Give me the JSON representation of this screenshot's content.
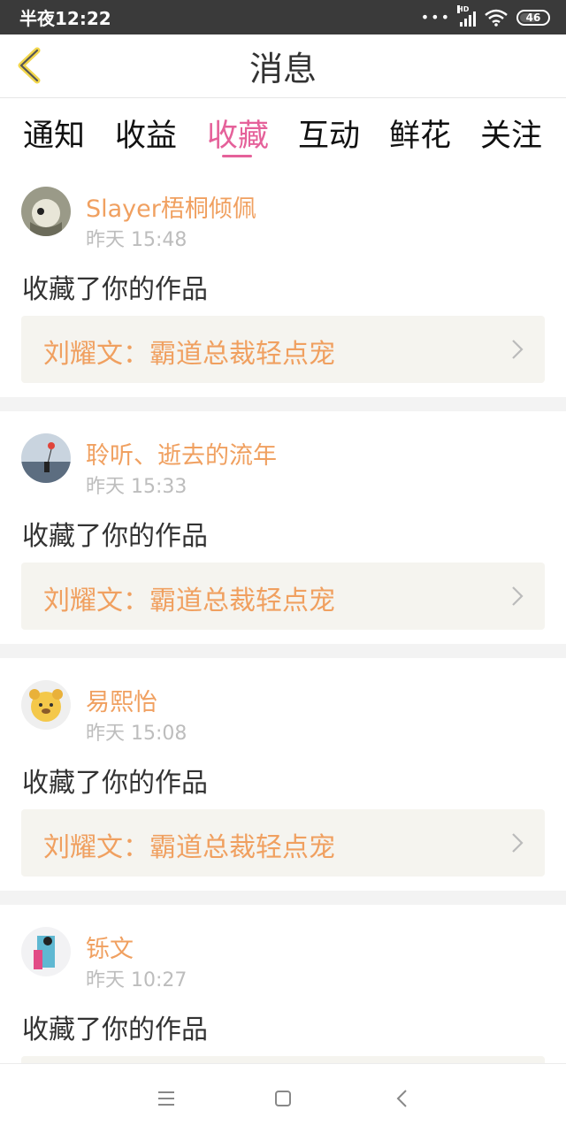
{
  "status": {
    "time": "半夜12:22",
    "signal_label": "HD",
    "battery": "46"
  },
  "header": {
    "title": "消息"
  },
  "tabs": [
    {
      "label": "通知"
    },
    {
      "label": "收益"
    },
    {
      "label": "收藏",
      "active": true
    },
    {
      "label": "互动"
    },
    {
      "label": "鲜花"
    },
    {
      "label": "关注"
    }
  ],
  "messages": [
    {
      "user": "Slayer梧桐倾佩",
      "time": "昨天 15:48",
      "action": "收藏了你的作品",
      "work": "刘耀文：霸道总裁轻点宠"
    },
    {
      "user": "聆听、逝去的流年",
      "time": "昨天 15:33",
      "action": "收藏了你的作品",
      "work": "刘耀文：霸道总裁轻点宠"
    },
    {
      "user": "易熙怡",
      "time": "昨天 15:08",
      "action": "收藏了你的作品",
      "work": "刘耀文：霸道总裁轻点宠"
    },
    {
      "user": "铄文",
      "time": "昨天 10:27",
      "action": "收藏了你的作品",
      "work": ""
    }
  ],
  "colors": {
    "accent": "#e5619a",
    "username": "#f0a060",
    "card_bg": "#f5f4ef"
  }
}
